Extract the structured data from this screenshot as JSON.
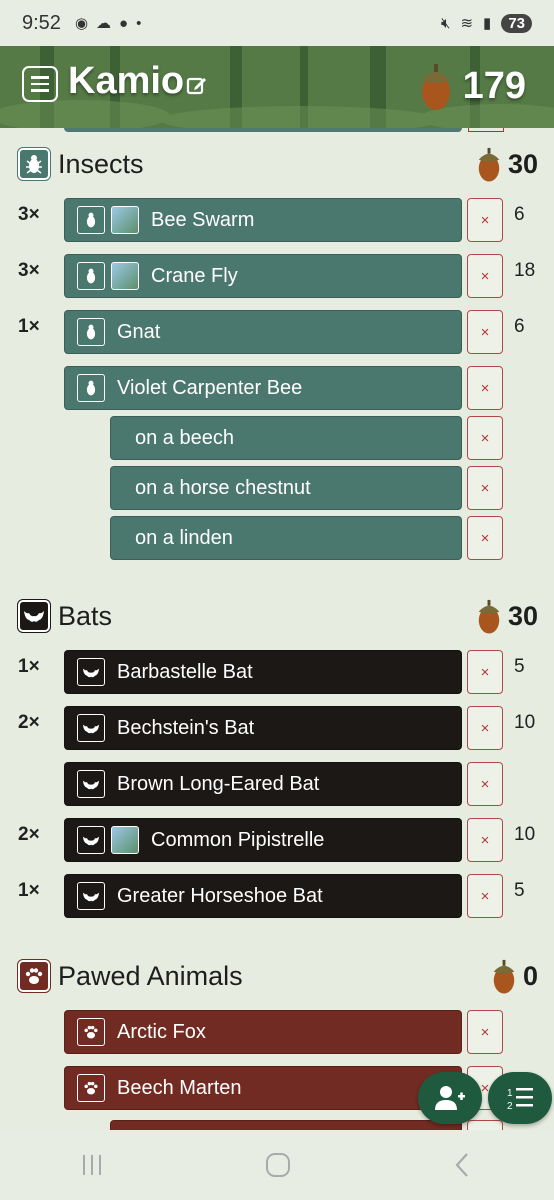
{
  "status": {
    "time": "9:52",
    "battery": "73"
  },
  "header": {
    "title": "Kamio",
    "total": "179"
  },
  "colors": {
    "insects": "#4a776e",
    "bats": "#1b1815",
    "pawed": "#722b22",
    "fab": "#1f5a3e"
  },
  "sections": {
    "insects": {
      "title": "Insects",
      "score": "30",
      "rows": [
        {
          "qty": "3×",
          "label": "Bee Swarm",
          "pts": "6",
          "icons": [
            "bug-icon",
            "tree-icon"
          ]
        },
        {
          "qty": "3×",
          "label": "Crane Fly",
          "pts": "18",
          "icons": [
            "bug-icon",
            "tree-icon"
          ]
        },
        {
          "qty": "1×",
          "label": "Gnat",
          "pts": "6",
          "icons": [
            "bug-icon"
          ]
        },
        {
          "qty": "",
          "label": "Violet Carpenter Bee",
          "pts": "",
          "icons": [
            "bug-icon"
          ]
        }
      ],
      "subrows": [
        {
          "label": "on a beech"
        },
        {
          "label": "on a horse chestnut"
        },
        {
          "label": "on a linden"
        }
      ]
    },
    "bats": {
      "title": "Bats",
      "score": "30",
      "rows": [
        {
          "qty": "1×",
          "label": "Barbastelle Bat",
          "pts": "5",
          "icons": [
            "bat-icon"
          ]
        },
        {
          "qty": "2×",
          "label": "Bechstein's Bat",
          "pts": "10",
          "icons": [
            "bat-icon"
          ]
        },
        {
          "qty": "",
          "label": "Brown Long-Eared Bat",
          "pts": "",
          "icons": [
            "bat-icon"
          ]
        },
        {
          "qty": "2×",
          "label": "Common Pipistrelle",
          "pts": "10",
          "icons": [
            "bat-icon",
            "tree-icon"
          ]
        },
        {
          "qty": "1×",
          "label": "Greater Horseshoe Bat",
          "pts": "5",
          "icons": [
            "bat-icon"
          ]
        }
      ]
    },
    "pawed": {
      "title": "Pawed Animals",
      "score": "0",
      "rows": [
        {
          "qty": "",
          "label": "Arctic Fox",
          "pts": "",
          "icons": [
            "paw-icon"
          ]
        },
        {
          "qty": "",
          "label": "Beech Marten",
          "pts": "",
          "icons": [
            "paw-icon"
          ]
        }
      ]
    }
  },
  "remove_label": "×"
}
